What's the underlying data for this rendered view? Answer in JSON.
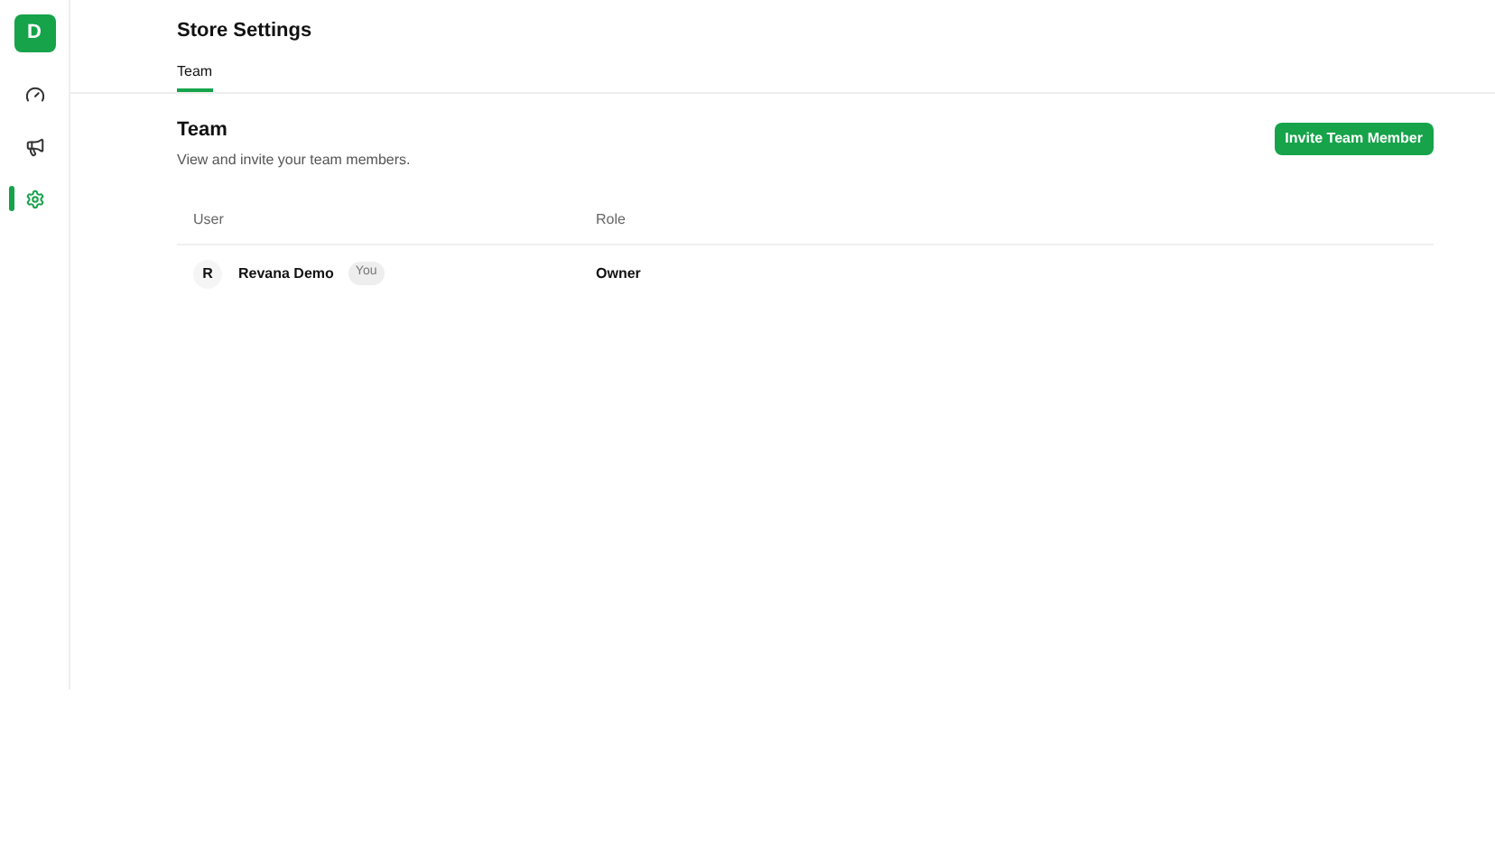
{
  "sidebar": {
    "logo": "D",
    "items": [
      {
        "kind": "gauge",
        "selected": false
      },
      {
        "kind": "megaphone",
        "selected": false
      },
      {
        "kind": "settings",
        "selected": true
      }
    ]
  },
  "header": {
    "title": "Store Settings",
    "tabs": [
      {
        "label": "Team",
        "selected": true
      }
    ]
  },
  "section": {
    "title": "Team",
    "description": "View and invite your team members.",
    "button": "Invite Team Member"
  },
  "table": {
    "columns": [
      "User",
      "Role"
    ],
    "rows": [
      {
        "initial": "R",
        "name": "Revana Demo",
        "badge": "You",
        "role": "Owner"
      }
    ]
  }
}
